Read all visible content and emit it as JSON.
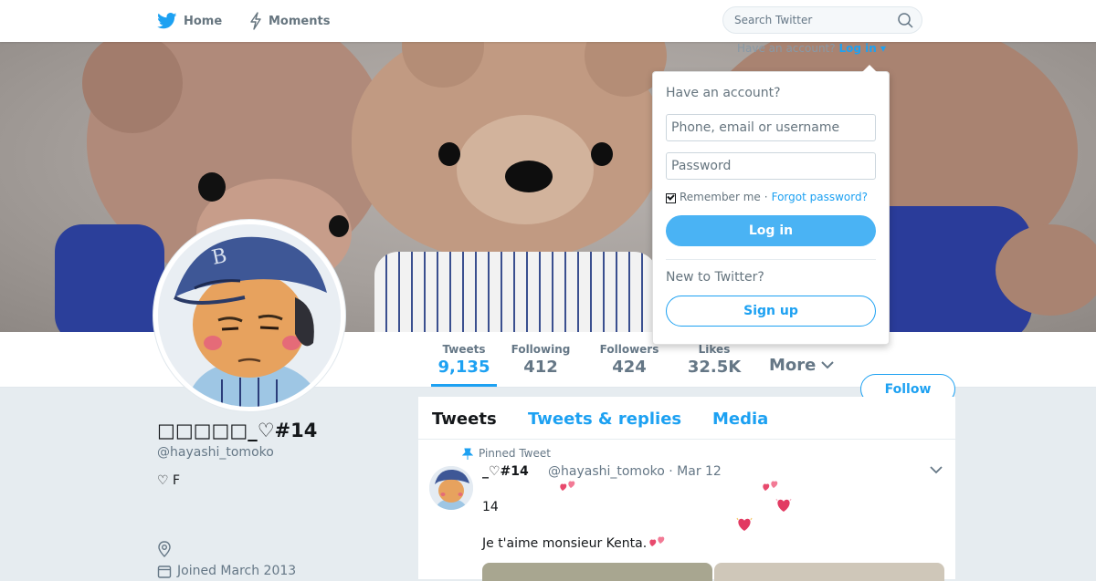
{
  "nav": {
    "home_label": "Home",
    "moments_label": "Moments",
    "search_placeholder": "Search Twitter",
    "account_prompt": "Have an account?",
    "login_link": "Log in ▾"
  },
  "colors": {
    "accent": "#1da1f2",
    "login_button": "#4ab3f4",
    "text_muted": "#657786"
  },
  "profile": {
    "name": "□□□□□_♡#14",
    "handle": "@hayashi_tomoko",
    "bio": "♡ F",
    "joined": "Joined March 2013"
  },
  "stats": [
    {
      "label": "Tweets",
      "value": "9,135"
    },
    {
      "label": "Following",
      "value": "412"
    },
    {
      "label": "Followers",
      "value": "424"
    },
    {
      "label": "Likes",
      "value": "32.5K"
    }
  ],
  "more_label": "More",
  "follow_label": "Follow",
  "timeline": {
    "tabs": [
      "Tweets",
      "Tweets & replies",
      "Media"
    ],
    "pinned_label": "Pinned Tweet",
    "tweet": {
      "name": "_♡#14",
      "meta": "@hayashi_tomoko · Mar 12",
      "line1": "14",
      "line2": "Je t'aime monsieur Kenta."
    }
  },
  "login_dropdown": {
    "title": "Have an account?",
    "username_placeholder": "Phone, email or username",
    "password_placeholder": "Password",
    "remember_label": "Remember me",
    "separator": "·",
    "forgot_label": "Forgot password?",
    "login_button": "Log in",
    "new_label": "New to Twitter?",
    "signup_button": "Sign up"
  }
}
